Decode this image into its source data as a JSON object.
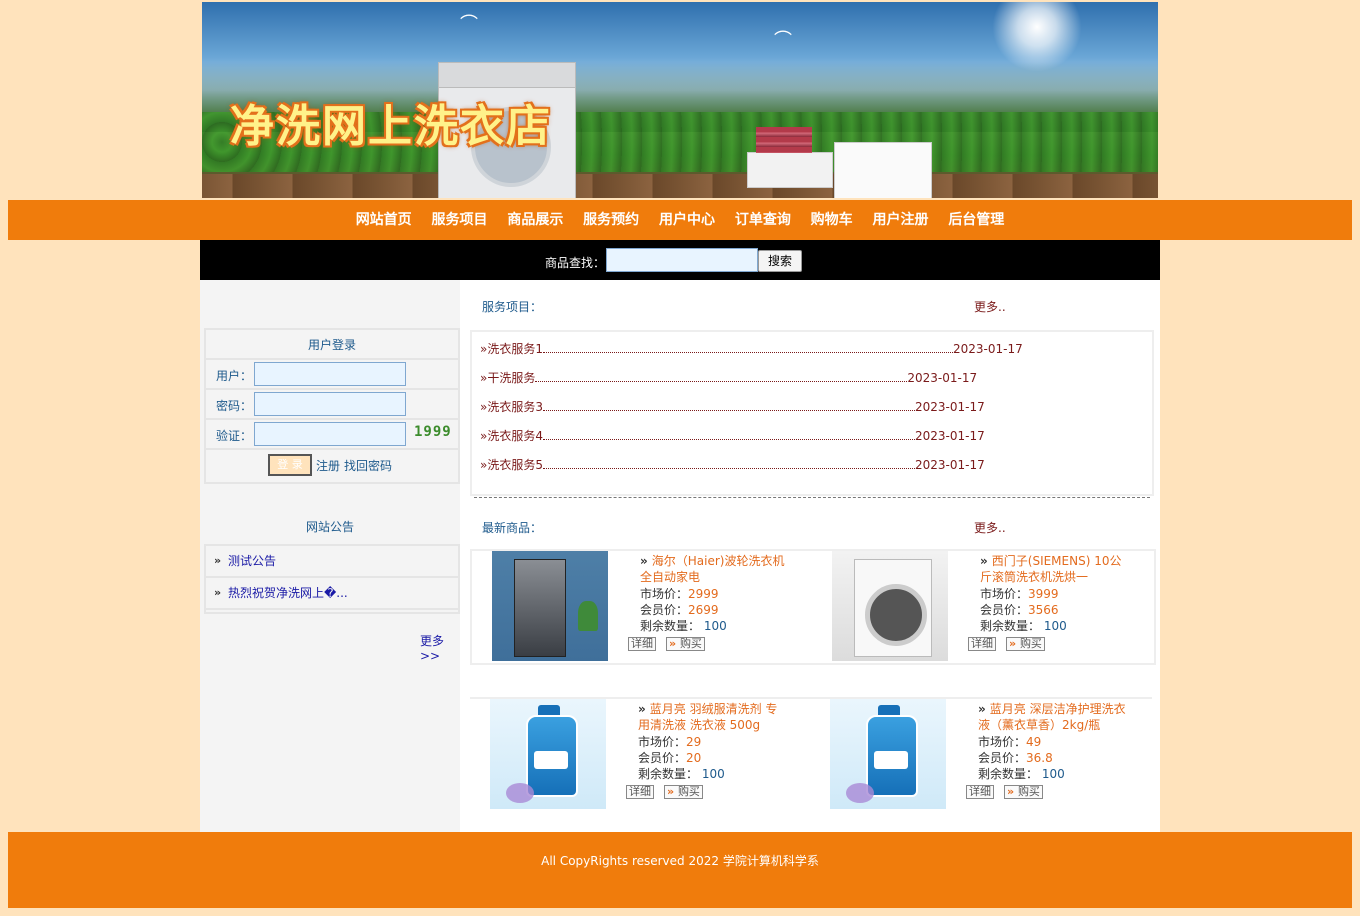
{
  "banner": {
    "title": "净洗网上洗衣店"
  },
  "nav": {
    "items": [
      "网站首页",
      "服务项目",
      "商品展示",
      "服务预约",
      "用户中心",
      "订单查询",
      "购物车",
      "用户注册",
      "后台管理"
    ]
  },
  "search": {
    "label": "商品查找：",
    "value": "",
    "button": "搜索"
  },
  "login": {
    "title": "用户登录",
    "user_label": "用户：",
    "pass_label": "密码：",
    "captcha_label": "验证：",
    "captcha_code": "1999",
    "submit": "登 录",
    "register": "注册",
    "forgot": "找回密码"
  },
  "notice": {
    "title": "网站公告",
    "items": [
      "测试公告",
      "热烈祝贺净洗网上�..."
    ],
    "more": "更多>>"
  },
  "services": {
    "title": "服务项目：",
    "more": "更多..",
    "items": [
      {
        "name": "洗衣服务1",
        "date": "2023-01-17"
      },
      {
        "name": "干洗服务",
        "date": "2023-01-17"
      },
      {
        "name": "洗衣服务3",
        "date": "2023-01-17"
      },
      {
        "name": "洗衣服务4",
        "date": "2023-01-17"
      },
      {
        "name": "洗衣服务5",
        "date": "2023-01-17"
      }
    ]
  },
  "products": {
    "title": "最新商品：",
    "more": "更多..",
    "market_label": "市场价：",
    "member_label": "会员价：",
    "stock_label": "剩余数量：",
    "detail_btn": "详细",
    "buy_btn": "购买",
    "items": [
      {
        "name": "海尔（Haier)波轮洗衣机全自动家电",
        "market": "2999",
        "member": "2699",
        "stock": "100",
        "icon": "washer-image"
      },
      {
        "name": "西门子(SIEMENS) 10公斤滚筒洗衣机洗烘一",
        "market": "3999",
        "member": "3566",
        "stock": "100",
        "icon": "washer-image"
      },
      {
        "name": "蓝月亮 羽绒服清洗剂 专用清洗液 洗衣液 500g",
        "market": "29",
        "member": "20",
        "stock": "100",
        "icon": "detergent-image"
      },
      {
        "name": "蓝月亮 深层洁净护理洗衣液（薰衣草香）2kg/瓶",
        "market": "49",
        "member": "36.8",
        "stock": "100",
        "icon": "detergent-image"
      }
    ]
  },
  "footer": {
    "text": "All CopyRights reserved 2022 学院计算机科学系"
  },
  "colors": {
    "page_bg": "#ffe3bc",
    "nav_bg": "#f07c0c",
    "price": "#e36b1e",
    "link": "#1e5a8c"
  }
}
